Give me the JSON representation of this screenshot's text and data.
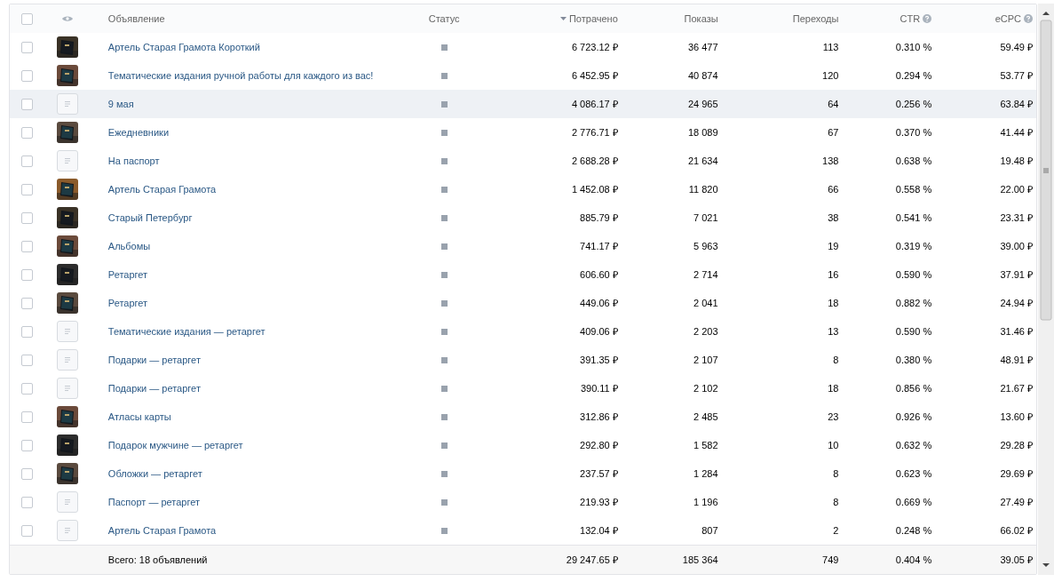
{
  "table": {
    "all_checked": false,
    "columns": [
      {
        "label": "Объявление",
        "sorted": false,
        "help": false
      },
      {
        "label": "Статус",
        "sorted": false,
        "help": false
      },
      {
        "label": "Потрачено",
        "sorted": true,
        "help": false
      },
      {
        "label": "Показы",
        "sorted": false,
        "help": false
      },
      {
        "label": "Переходы",
        "sorted": false,
        "help": false
      },
      {
        "label": "CTR",
        "sorted": false,
        "help": true
      },
      {
        "label": "eCPC",
        "sorted": false,
        "help": true
      }
    ],
    "rows": [
      {
        "kind": "picture",
        "name": "Артель Старая Грамота Короткий",
        "checked": false,
        "highlighted": false,
        "spent": "6 723.12 ₽",
        "shows": "36 477",
        "clicks": "113",
        "ctr": "0.310 %",
        "ecpc": "59.49 ₽"
      },
      {
        "kind": "picture",
        "name": "Тематические издания ручной работы для каждого из вас!",
        "checked": false,
        "highlighted": false,
        "spent": "6 452.95 ₽",
        "shows": "40 874",
        "clicks": "120",
        "ctr": "0.294 %",
        "ecpc": "53.77 ₽"
      },
      {
        "kind": "none",
        "name": "9 мая",
        "checked": false,
        "highlighted": true,
        "spent": "4 086.17 ₽",
        "shows": "24 965",
        "clicks": "64",
        "ctr": "0.256 %",
        "ecpc": "63.84 ₽"
      },
      {
        "kind": "picture",
        "name": "Ежедневники",
        "checked": false,
        "highlighted": false,
        "spent": "2 776.71 ₽",
        "shows": "18 089",
        "clicks": "67",
        "ctr": "0.370 %",
        "ecpc": "41.44 ₽"
      },
      {
        "kind": "none",
        "name": "На паспорт",
        "checked": false,
        "highlighted": false,
        "spent": "2 688.28 ₽",
        "shows": "21 634",
        "clicks": "138",
        "ctr": "0.638 %",
        "ecpc": "19.48 ₽"
      },
      {
        "kind": "picture",
        "name": "Артель Старая Грамота",
        "checked": false,
        "highlighted": false,
        "spent": "1 452.08 ₽",
        "shows": "11 820",
        "clicks": "66",
        "ctr": "0.558 %",
        "ecpc": "22.00 ₽"
      },
      {
        "kind": "picture",
        "name": "Старый Петербург",
        "checked": false,
        "highlighted": false,
        "spent": "885.79 ₽",
        "shows": "7 021",
        "clicks": "38",
        "ctr": "0.541 %",
        "ecpc": "23.31 ₽"
      },
      {
        "kind": "picture",
        "name": "Альбомы",
        "checked": false,
        "highlighted": false,
        "spent": "741.17 ₽",
        "shows": "5 963",
        "clicks": "19",
        "ctr": "0.319 %",
        "ecpc": "39.00 ₽"
      },
      {
        "kind": "picture",
        "name": "Ретаргет",
        "checked": false,
        "highlighted": false,
        "spent": "606.60 ₽",
        "shows": "2 714",
        "clicks": "16",
        "ctr": "0.590 %",
        "ecpc": "37.91 ₽"
      },
      {
        "kind": "picture",
        "name": "Ретаргет",
        "checked": false,
        "highlighted": false,
        "spent": "449.06 ₽",
        "shows": "2 041",
        "clicks": "18",
        "ctr": "0.882 %",
        "ecpc": "24.94 ₽"
      },
      {
        "kind": "none",
        "name": "Тематические издания — ретаргет",
        "checked": false,
        "highlighted": false,
        "spent": "409.06 ₽",
        "shows": "2 203",
        "clicks": "13",
        "ctr": "0.590 %",
        "ecpc": "31.46 ₽"
      },
      {
        "kind": "none",
        "name": "Подарки — ретаргет",
        "checked": false,
        "highlighted": false,
        "spent": "391.35 ₽",
        "shows": "2 107",
        "clicks": "8",
        "ctr": "0.380 %",
        "ecpc": "48.91 ₽"
      },
      {
        "kind": "none",
        "name": "Подарки — ретаргет",
        "checked": false,
        "highlighted": false,
        "spent": "390.11 ₽",
        "shows": "2 102",
        "clicks": "18",
        "ctr": "0.856 %",
        "ecpc": "21.67 ₽"
      },
      {
        "kind": "picture",
        "name": "Атласы карты",
        "checked": false,
        "highlighted": false,
        "spent": "312.86 ₽",
        "shows": "2 485",
        "clicks": "23",
        "ctr": "0.926 %",
        "ecpc": "13.60 ₽"
      },
      {
        "kind": "picture",
        "name": "Подарок мужчине — ретаргет",
        "checked": false,
        "highlighted": false,
        "spent": "292.80 ₽",
        "shows": "1 582",
        "clicks": "10",
        "ctr": "0.632 %",
        "ecpc": "29.28 ₽"
      },
      {
        "kind": "picture",
        "name": "Обложки — ретаргет",
        "checked": false,
        "highlighted": false,
        "spent": "237.57 ₽",
        "shows": "1 284",
        "clicks": "8",
        "ctr": "0.623 %",
        "ecpc": "29.69 ₽"
      },
      {
        "kind": "none",
        "name": "Паспорт — ретаргет",
        "checked": false,
        "highlighted": false,
        "spent": "219.93 ₽",
        "shows": "1 196",
        "clicks": "8",
        "ctr": "0.669 %",
        "ecpc": "27.49 ₽"
      },
      {
        "kind": "none",
        "name": "Артель Старая Грамота",
        "checked": false,
        "highlighted": false,
        "spent": "132.04 ₽",
        "shows": "807",
        "clicks": "2",
        "ctr": "0.248 %",
        "ecpc": "66.02 ₽"
      }
    ],
    "total": {
      "label": "Всего: 18 объявлений",
      "spent": "29 247.65 ₽",
      "shows": "185 364",
      "clicks": "749",
      "ctr": "0.404 %",
      "ecpc": "39.05 ₽"
    }
  }
}
